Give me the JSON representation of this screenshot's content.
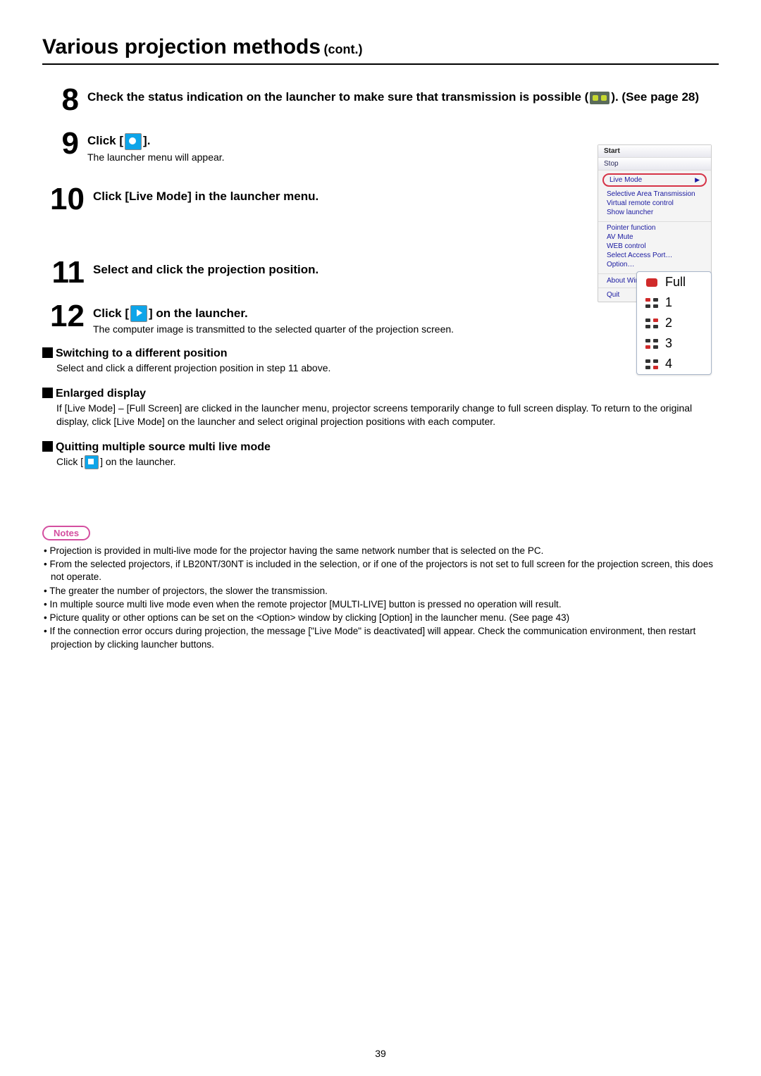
{
  "title": {
    "main": "Various projection methods",
    "cont": "(cont.)"
  },
  "steps": {
    "s8": {
      "num": "8",
      "title_a": "Check the status indication on the launcher to make sure that transmission is possible (",
      "title_b": "). (See page 28)"
    },
    "s9": {
      "num": "9",
      "title_a": "Click [",
      "title_b": "].",
      "text": "The launcher menu will appear."
    },
    "s10": {
      "num": "10",
      "title": "Click [Live Mode] in the launcher menu."
    },
    "s11": {
      "num": "11",
      "title": "Select and click the projection position."
    },
    "s12": {
      "num": "12",
      "title_a": "Click [",
      "title_b": "] on the launcher.",
      "text": "The computer image is transmitted to the selected quarter of the projection screen."
    }
  },
  "sideMenu": {
    "start": "Start",
    "stop": "Stop",
    "liveMode": "Live Mode",
    "items1": {
      "a": "Selective Area Transmission",
      "b": "Virtual remote control",
      "c": "Show launcher"
    },
    "items2": {
      "a": "Pointer function",
      "b": "AV Mute",
      "c": "WEB control",
      "d": "Select Access Port…",
      "e": "Option…"
    },
    "about": "About Wireless Manager",
    "quit": "Quit"
  },
  "projMenu": {
    "full": "Full",
    "p1": "1",
    "p2": "2",
    "p3": "3",
    "p4": "4"
  },
  "sections": {
    "switching": {
      "head": "Switching to a different position",
      "body": "Select and click a different projection position in step 11 above."
    },
    "enlarged": {
      "head": "Enlarged display",
      "body": "If [Live Mode] – [Full Screen] are clicked in the launcher menu, projector screens temporarily change to full screen display. To return to the original display, click [Live Mode] on the launcher and select original projection positions with each computer."
    },
    "quitting": {
      "head": "Quitting multiple source multi live mode",
      "body_a": "Click [",
      "body_b": "] on the launcher."
    }
  },
  "notes": {
    "badge": "Notes",
    "n1": "• Projection is provided in multi-live mode for the projector having the same network number that is selected on the PC.",
    "n2": "• From the selected projectors, if LB20NT/30NT is included in the selection, or if one of the projectors is not set to full screen for the projection screen, this does not operate.",
    "n3": "• The greater the number of projectors, the slower the transmission.",
    "n4": "• In multiple source multi live mode even when the remote projector [MULTI-LIVE] button is pressed no operation will result.",
    "n5": "• Picture quality or other options can be set on the <Option> window by clicking [Option] in the launcher menu. (See page 43)",
    "n6": "• If the connection error occurs during projection, the message [\"Live Mode\" is deactivated] will appear. Check the communication environment, then restart projection by clicking launcher buttons."
  },
  "pageNum": "39"
}
